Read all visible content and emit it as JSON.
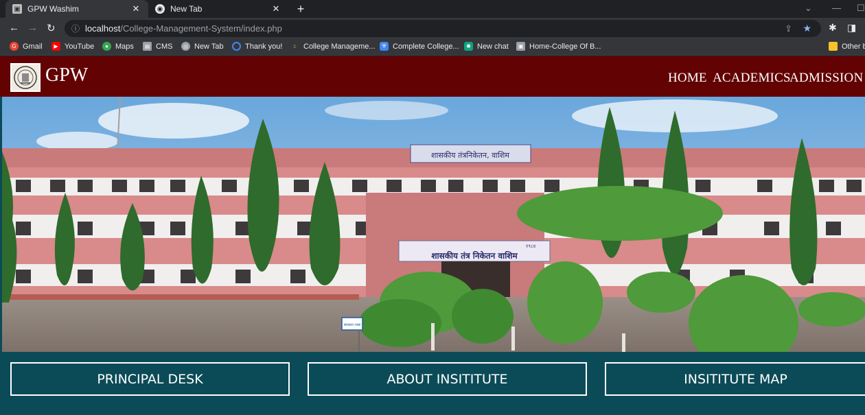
{
  "browser": {
    "tabs": [
      {
        "title": "GPW Washim",
        "active": true
      },
      {
        "title": "New Tab",
        "active": false
      }
    ],
    "url": {
      "host": "localhost",
      "path": "/College-Management-System/index.php"
    },
    "bookmarks": [
      {
        "label": "Gmail",
        "icon": "gmail-icon",
        "color": "#ea4335"
      },
      {
        "label": "YouTube",
        "icon": "youtube-icon",
        "color": "#ff0000"
      },
      {
        "label": "Maps",
        "icon": "maps-icon",
        "color": "#34a853"
      },
      {
        "label": "CMS",
        "icon": "cms-icon",
        "color": "#9aa0a6"
      },
      {
        "label": "New Tab",
        "icon": "globe-icon",
        "color": "#9aa0a6"
      },
      {
        "label": "Thank you!",
        "icon": "spinner-icon",
        "color": "#4285f4"
      },
      {
        "label": "College Manageme...",
        "icon": "c-icon",
        "color": "#188038"
      },
      {
        "label": "Complete College...",
        "icon": "shield-icon",
        "color": "#4285f4"
      },
      {
        "label": "New chat",
        "icon": "chat-icon",
        "color": "#10a37f"
      },
      {
        "label": "Home-College Of B...",
        "icon": "page-icon",
        "color": "#9aa0a6"
      }
    ],
    "other_bookmarks": "Other b"
  },
  "site": {
    "brand": "GPW",
    "nav": [
      "HOME",
      "ACADEMICS",
      "ADMISSION"
    ],
    "hero": {
      "top_banner": "शासकीय तंत्रनिकेतन, वाशिम",
      "entrance_banner": "शासकीय तंत्र निकेतन वाशिम",
      "entrance_tag": "१९८४",
      "sign": "स्वच्छता राखा"
    },
    "quick_links": [
      "PRINCIPAL DESK",
      "ABOUT INSITITUTE",
      "INSITITUTE MAP"
    ],
    "colors": {
      "navbar": "#620203",
      "section": "#0b4b57",
      "building": "#d98a8a"
    }
  }
}
